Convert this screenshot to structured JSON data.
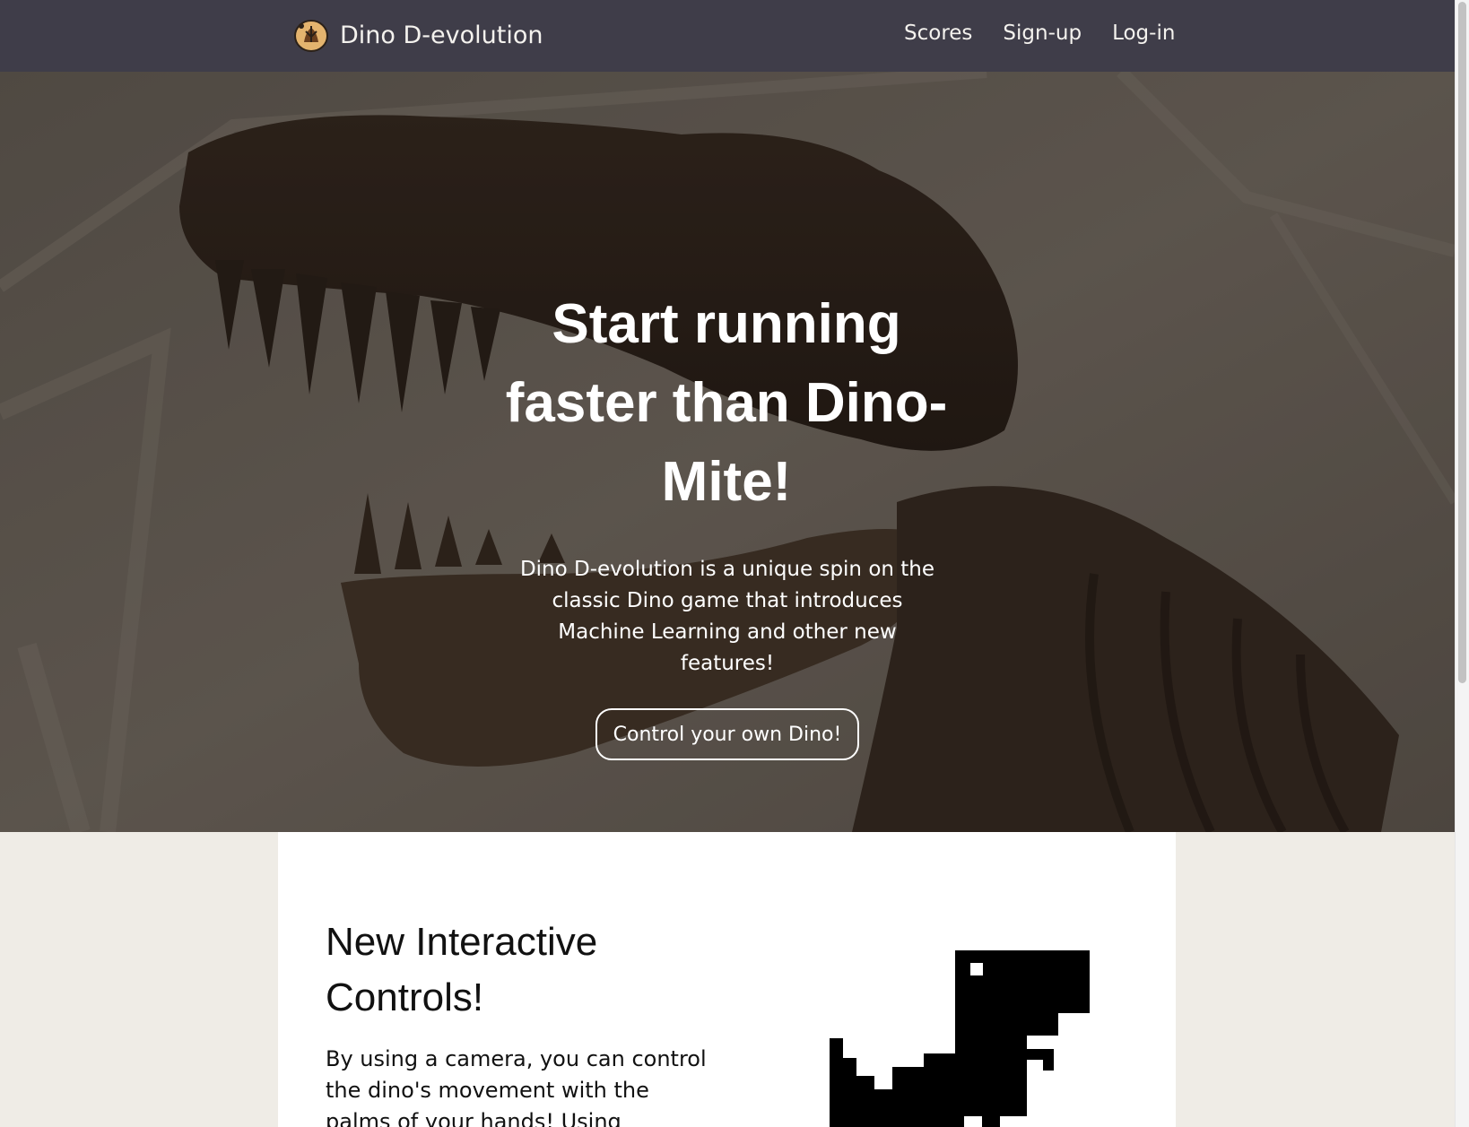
{
  "navbar": {
    "brand_name": "Dino D-evolution",
    "links": [
      "Scores",
      "Sign-up",
      "Log-in"
    ]
  },
  "hero": {
    "title_lines": [
      "Start running",
      "faster than Dino-",
      "Mite!"
    ],
    "description": "Dino D-evolution is a unique spin on the classic Dino game that introduces Machine Learning and other new features!",
    "button_label": "Control your own Dino!"
  },
  "feature": {
    "title": "New Interactive Controls!",
    "text": "By using a camera, you can control the dino's movement with the palms of your hands! Using"
  },
  "colors": {
    "navbar_bg": "#3f3d49",
    "page_bg": "#efece6",
    "card_bg": "#ffffff",
    "hero_text": "#ffffff"
  },
  "icons": [
    "dino-egg-logo-icon",
    "pixel-dino-icon"
  ]
}
